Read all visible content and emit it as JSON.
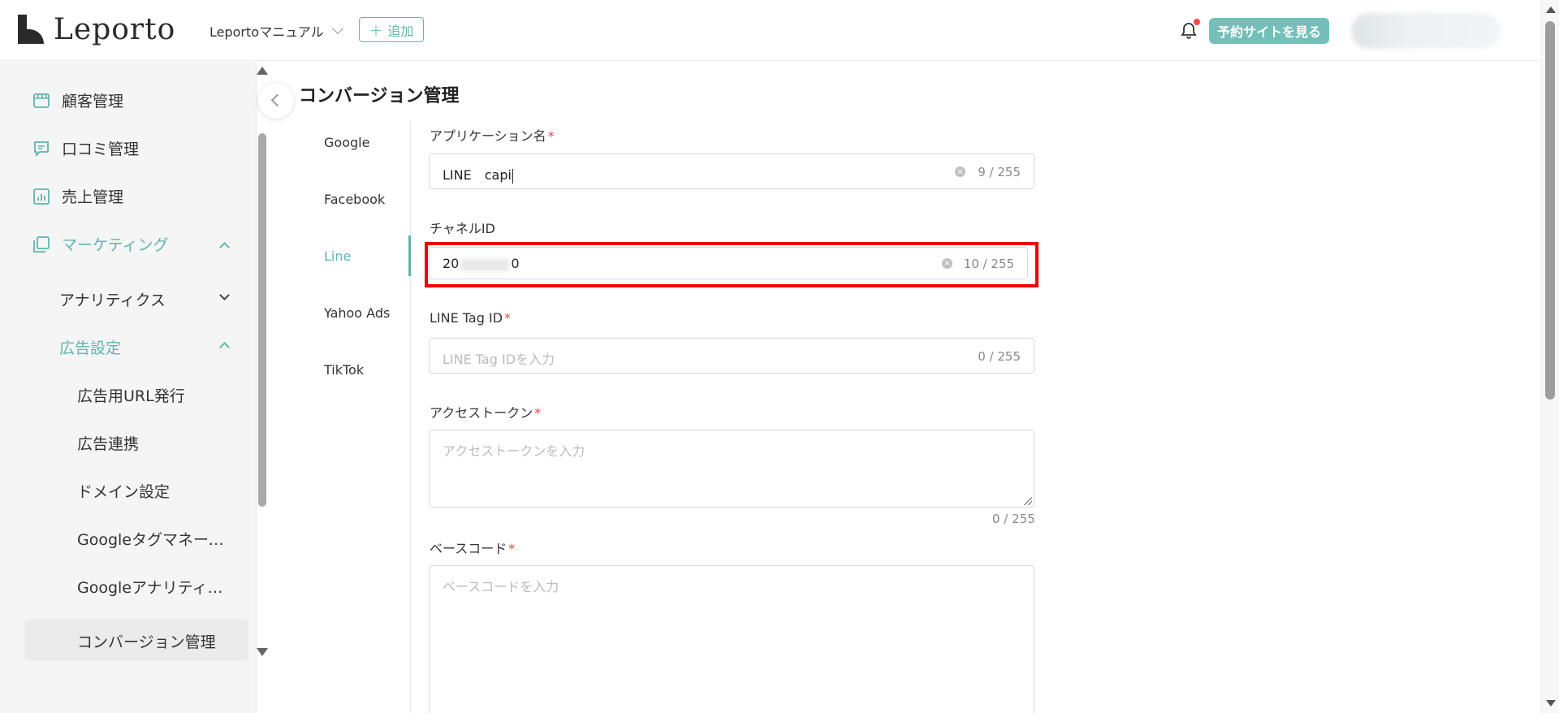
{
  "header": {
    "logo_text": "Leporto",
    "site_name": "Leportoマニュアル",
    "add_label": "追加",
    "view_site_label": "予約サイトを見る"
  },
  "sidebar": {
    "items": [
      {
        "label": "顧客管理"
      },
      {
        "label": "口コミ管理"
      },
      {
        "label": "売上管理"
      },
      {
        "label": "マーケティング"
      }
    ],
    "analytics": "アナリティクス",
    "ad_settings": "広告設定",
    "sub_items": [
      {
        "label": "広告用URL発行"
      },
      {
        "label": "広告連携"
      },
      {
        "label": "ドメイン設定"
      },
      {
        "label": "Googleタグマネージャー"
      },
      {
        "label": "Googleアナリティクス"
      },
      {
        "label": "コンバージョン管理"
      }
    ]
  },
  "main": {
    "page_title": "コンバージョン管理",
    "tabs": [
      {
        "label": "Google"
      },
      {
        "label": "Facebook"
      },
      {
        "label": "Line"
      },
      {
        "label": "Yahoo Ads"
      },
      {
        "label": "TikTok"
      }
    ],
    "fields": {
      "app_name": {
        "label": "アプリケーション名",
        "value": "LINE　capi",
        "count": "9 / 255"
      },
      "channel_id": {
        "label": "チャネルID",
        "value_start": "20",
        "value_end": "0",
        "count": "10 / 255"
      },
      "line_tag_id": {
        "label": "LINE Tag ID",
        "placeholder": "LINE Tag IDを入力",
        "count": "0 / 255"
      },
      "access_token": {
        "label": "アクセストークン",
        "placeholder": "アクセストークンを入力",
        "count": "0 / 255"
      },
      "base_code": {
        "label": "ベースコード",
        "placeholder": "ベースコードを入力"
      }
    },
    "required_mark": "*"
  },
  "colors": {
    "accent": "#5fb5ad",
    "button_bg": "#74c0b8",
    "highlight": "#ee0000",
    "required": "#e64545"
  }
}
